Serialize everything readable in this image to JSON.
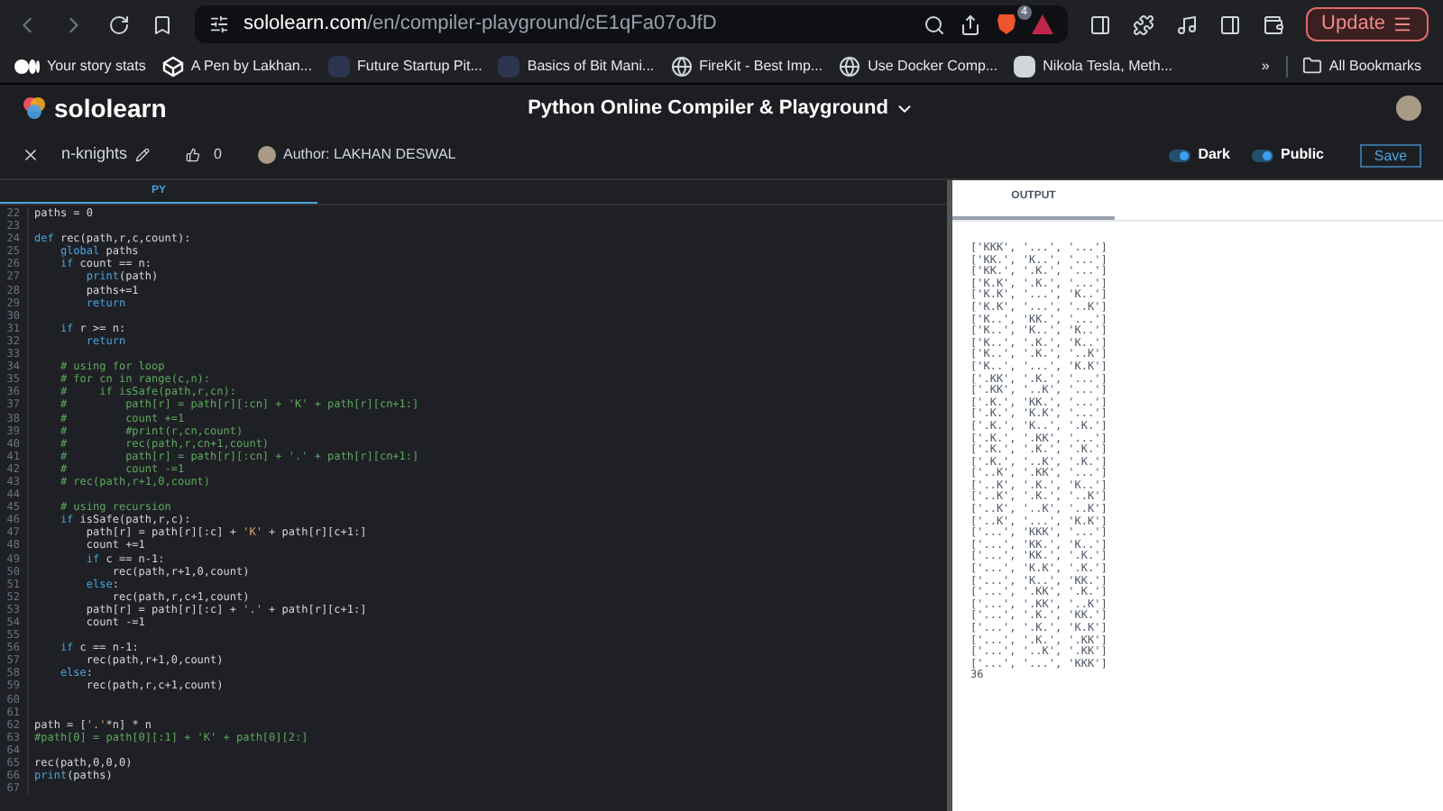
{
  "browser": {
    "url_host": "sololearn.com",
    "url_path": "/en/compiler-playground/cE1qFa07oJfD",
    "shield_count": "4",
    "update_label": "Update",
    "bookmarks": [
      {
        "label": "Your story stats",
        "kind": "medium"
      },
      {
        "label": "A Pen by Lakhan...",
        "kind": "codepen"
      },
      {
        "label": "Future Startup Pit...",
        "kind": "tile"
      },
      {
        "label": "Basics of Bit Mani...",
        "kind": "tile"
      },
      {
        "label": "FireKit - Best Imp...",
        "kind": "globe"
      },
      {
        "label": "Use Docker Comp...",
        "kind": "globe"
      },
      {
        "label": "Nikola Tesla, Meth...",
        "kind": "portrait"
      }
    ],
    "overflow": "»",
    "all_bookmarks": "All Bookmarks"
  },
  "site": {
    "logo": "sololearn",
    "title": "Python Online Compiler & Playground"
  },
  "toolbar": {
    "name": "n-knights",
    "likes": "0",
    "author": "Author: LAKHAN DESWAL",
    "toggles": [
      {
        "label": "Dark",
        "on": true
      },
      {
        "label": "Public",
        "on": true
      }
    ],
    "save": "Save"
  },
  "editor": {
    "tab": "PY",
    "lines": [
      {
        "n": "22",
        "segments": [
          {
            "kind": "plain",
            "text": "paths = 0"
          }
        ]
      },
      {
        "n": "23"
      },
      {
        "n": "24",
        "segments": [
          {
            "kind": "keyword",
            "text": "def"
          },
          {
            "kind": "plain",
            "text": " rec(path,r,c,count):"
          }
        ]
      },
      {
        "n": "25",
        "segments": [
          {
            "kind": "keyword",
            "text": "    global"
          },
          {
            "kind": "plain",
            "text": " paths"
          }
        ]
      },
      {
        "n": "26",
        "segments": [
          {
            "kind": "keyword",
            "text": "    if"
          },
          {
            "kind": "plain",
            "text": " count == n:"
          }
        ]
      },
      {
        "n": "27",
        "segments": [
          {
            "kind": "keyword",
            "text": "        print"
          },
          {
            "kind": "plain",
            "text": "(path)"
          }
        ]
      },
      {
        "n": "28",
        "segments": [
          {
            "kind": "plain",
            "text": "        paths+=1"
          }
        ]
      },
      {
        "n": "29",
        "segments": [
          {
            "kind": "keyword",
            "text": "        return"
          }
        ]
      },
      {
        "n": "30"
      },
      {
        "n": "31",
        "segments": [
          {
            "kind": "keyword",
            "text": "    if"
          },
          {
            "kind": "plain",
            "text": " r >= n:"
          }
        ]
      },
      {
        "n": "32",
        "segments": [
          {
            "kind": "keyword",
            "text": "        return"
          }
        ]
      },
      {
        "n": "33"
      },
      {
        "n": "34",
        "segments": [
          {
            "kind": "comment",
            "text": "    # using for loop"
          }
        ]
      },
      {
        "n": "35",
        "segments": [
          {
            "kind": "comment",
            "text": "    # for cn in range(c,n):"
          }
        ]
      },
      {
        "n": "36",
        "segments": [
          {
            "kind": "comment",
            "text": "    #     if isSafe(path,r,cn):"
          }
        ]
      },
      {
        "n": "37",
        "segments": [
          {
            "kind": "comment",
            "text": "    #         path[r] = path[r][:cn] + 'K' + path[r][cn+1:]"
          }
        ]
      },
      {
        "n": "38",
        "segments": [
          {
            "kind": "comment",
            "text": "    #         count +=1"
          }
        ]
      },
      {
        "n": "39",
        "segments": [
          {
            "kind": "comment",
            "text": "    #         #print(r,cn,count)"
          }
        ]
      },
      {
        "n": "40",
        "segments": [
          {
            "kind": "comment",
            "text": "    #         rec(path,r,cn+1,count)"
          }
        ]
      },
      {
        "n": "41",
        "segments": [
          {
            "kind": "comment",
            "text": "    #         path[r] = path[r][:cn] + '.' + path[r][cn+1:]"
          }
        ]
      },
      {
        "n": "42",
        "segments": [
          {
            "kind": "comment",
            "text": "    #         count -=1"
          }
        ]
      },
      {
        "n": "43",
        "segments": [
          {
            "kind": "comment",
            "text": "    # rec(path,r+1,0,count)"
          }
        ]
      },
      {
        "n": "44"
      },
      {
        "n": "45",
        "segments": [
          {
            "kind": "comment",
            "text": "    # using recursion"
          }
        ]
      },
      {
        "n": "46",
        "segments": [
          {
            "kind": "keyword",
            "text": "    if"
          },
          {
            "kind": "plain",
            "text": " isSafe(path,r,c):"
          }
        ]
      },
      {
        "n": "47",
        "segments": [
          {
            "kind": "plain",
            "text": "        path[r] = path[r][:c] + "
          },
          {
            "kind": "string",
            "text": "'K'"
          },
          {
            "kind": "plain",
            "text": " + path[r][c+1:]"
          }
        ]
      },
      {
        "n": "48",
        "segments": [
          {
            "kind": "plain",
            "text": "        count +=1"
          }
        ]
      },
      {
        "n": "49",
        "segments": [
          {
            "kind": "keyword",
            "text": "        if"
          },
          {
            "kind": "plain",
            "text": " c == n-1:"
          }
        ]
      },
      {
        "n": "50",
        "segments": [
          {
            "kind": "plain",
            "text": "            rec(path,r+1,0,count)"
          }
        ]
      },
      {
        "n": "51",
        "segments": [
          {
            "kind": "keyword",
            "text": "        else"
          },
          {
            "kind": "plain",
            "text": ":"
          }
        ]
      },
      {
        "n": "52",
        "segments": [
          {
            "kind": "plain",
            "text": "            rec(path,r,c+1,count)"
          }
        ]
      },
      {
        "n": "53",
        "segments": [
          {
            "kind": "plain",
            "text": "        path[r] = path[r][:c] + "
          },
          {
            "kind": "string",
            "text": "'.'"
          },
          {
            "kind": "plain",
            "text": " + path[r][c+1:]"
          }
        ]
      },
      {
        "n": "54",
        "segments": [
          {
            "kind": "plain",
            "text": "        count -=1"
          }
        ]
      },
      {
        "n": "55"
      },
      {
        "n": "56",
        "segments": [
          {
            "kind": "keyword",
            "text": "    if"
          },
          {
            "kind": "plain",
            "text": " c == n-1:"
          }
        ]
      },
      {
        "n": "57",
        "segments": [
          {
            "kind": "plain",
            "text": "        rec(path,r+1,0,count)"
          }
        ]
      },
      {
        "n": "58",
        "segments": [
          {
            "kind": "keyword",
            "text": "    else"
          },
          {
            "kind": "plain",
            "text": ":"
          }
        ]
      },
      {
        "n": "59",
        "segments": [
          {
            "kind": "plain",
            "text": "        rec(path,r,c+1,count)"
          }
        ]
      },
      {
        "n": "60"
      },
      {
        "n": "61"
      },
      {
        "n": "62",
        "segments": [
          {
            "kind": "plain",
            "text": "path = ["
          },
          {
            "kind": "string",
            "text": "'.'"
          },
          {
            "kind": "plain",
            "text": "*n] * n"
          }
        ]
      },
      {
        "n": "63",
        "segments": [
          {
            "kind": "comment",
            "text": "#path[0] = path[0][:1] + 'K' + path[0][2:]"
          }
        ]
      },
      {
        "n": "64"
      },
      {
        "n": "65",
        "segments": [
          {
            "kind": "plain",
            "text": "rec(path,0,0,0)"
          }
        ]
      },
      {
        "n": "66",
        "segments": [
          {
            "kind": "keyword",
            "text": "print"
          },
          {
            "kind": "plain",
            "text": "(paths)"
          }
        ]
      },
      {
        "n": "67"
      }
    ]
  },
  "output": {
    "tab": "OUTPUT",
    "lines": [
      "['KKK', '...', '...']",
      "['KK.', 'K..', '...']",
      "['KK.', '.K.', '...']",
      "['K.K', '.K.', '...']",
      "['K.K', '...', 'K..']",
      "['K.K', '...', '..K']",
      "['K..', 'KK.', '...']",
      "['K..', 'K..', 'K..']",
      "['K..', '.K.', 'K..']",
      "['K..', '.K.', '..K']",
      "['K..', '...', 'K.K']",
      "['.KK', '.K.', '...']",
      "['.KK', '..K', '...']",
      "['.K.', 'KK.', '...']",
      "['.K.', 'K.K', '...']",
      "['.K.', 'K..', '.K.']",
      "['.K.', '.KK', '...']",
      "['.K.', '.K.', '.K.']",
      "['.K.', '..K', '.K.']",
      "['..K', '.KK', '...']",
      "['..K', '.K.', 'K..']",
      "['..K', '.K.', '..K']",
      "['..K', '..K', '..K']",
      "['..K', '...', 'K.K']",
      "['...', 'KKK', '...']",
      "['...', 'KK.', 'K..']",
      "['...', 'KK.', '.K.']",
      "['...', 'K.K', '.K.']",
      "['...', 'K..', 'KK.']",
      "['...', '.KK', '.K.']",
      "['...', '.KK', '..K']",
      "['...', '.K.', 'KK.']",
      "['...', '.K.', 'K.K']",
      "['...', '.K.', '.KK']",
      "['...', '..K', '.KK']",
      "['...', '...', 'KKK']",
      "36"
    ]
  }
}
